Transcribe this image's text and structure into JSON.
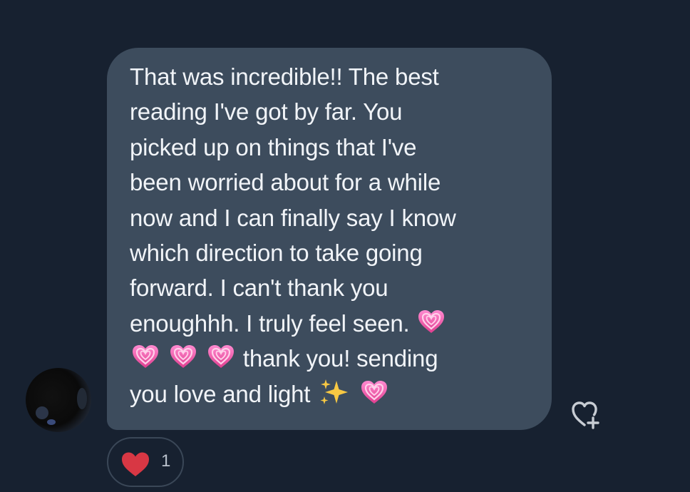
{
  "message": {
    "lines": [
      "That was incredible!! The best",
      "reading I've got by far. You",
      "picked up on things that I've",
      "been worried about for a while",
      "now and I can finally say I know",
      "which direction to take going",
      "forward. I can't thank you",
      "enoughhh. I truly feel seen.",
      "thank you! sending",
      "you love and light"
    ],
    "emojis": [
      "heart-emoji",
      "heart-emoji",
      "heart-emoji",
      "heart-emoji",
      "sparkles-emoji",
      "heart-emoji"
    ]
  },
  "reaction": {
    "icon": "red-heart-icon",
    "count": "1"
  },
  "add_reaction": {
    "icon": "heart-plus-icon"
  },
  "colors": {
    "background": "#172130",
    "bubble": "#3d4c5d",
    "text": "#f1f4f8",
    "heart_reaction": "#d83744",
    "heart_emoji": "#ff5fa8"
  }
}
